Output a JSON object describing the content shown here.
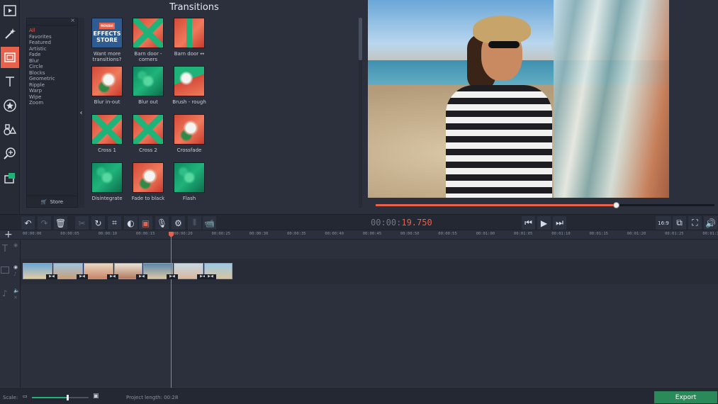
{
  "panel": {
    "title": "Transitions"
  },
  "categories": [
    "All",
    "Favorites",
    "Featured",
    "Artistic",
    "Fade",
    "Blur",
    "Circle",
    "Blocks",
    "Geometric",
    "Ripple",
    "Warp",
    "Wipe",
    "Zoom"
  ],
  "selected_category": "All",
  "store_label": "Store",
  "transitions": [
    {
      "label": "Want more transitions?",
      "kind": "store",
      "store_tag": "MOVAVI",
      "store_text": "EFFECTS STORE"
    },
    {
      "label": "Barn door - corners",
      "kind": "cross"
    },
    {
      "label": "Barn door ↔",
      "kind": "barn"
    },
    {
      "label": "Blur in-out",
      "kind": "flower"
    },
    {
      "label": "Blur out",
      "kind": "green"
    },
    {
      "label": "Brush - rough",
      "kind": "brush"
    },
    {
      "label": "Cross 1",
      "kind": "cross"
    },
    {
      "label": "Cross 2",
      "kind": "cross"
    },
    {
      "label": "Crossfade",
      "kind": "flower"
    },
    {
      "label": "Disintegrate",
      "kind": "green"
    },
    {
      "label": "Fade to black",
      "kind": "flower"
    },
    {
      "label": "Flash",
      "kind": "green"
    }
  ],
  "player": {
    "time_main": "00:00:",
    "time_ms": "19.750",
    "progress": 0.71,
    "aspect": "16:9"
  },
  "timeline": {
    "ticks": [
      "00:00:00",
      "00:00:05",
      "00:00:10",
      "00:00:15",
      "00:00:20",
      "00:00:25",
      "00:00:30",
      "00:00:35",
      "00:00:40",
      "00:00:45",
      "00:00:50",
      "00:00:55",
      "00:01:00",
      "00:01:05",
      "00:01:10",
      "00:01:15",
      "00:01:20",
      "00:01:25",
      "00:01:30"
    ]
  },
  "status": {
    "scale_label": "Scale:",
    "scale_value": 0.62,
    "project_length_label": "Project length:",
    "project_length": "00:28",
    "export_label": "Export"
  }
}
